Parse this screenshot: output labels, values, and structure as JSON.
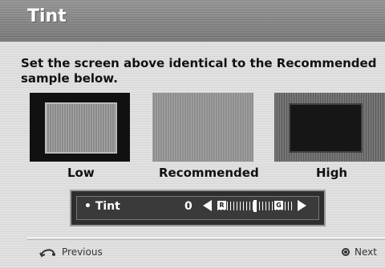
{
  "header": {
    "title": "Tint"
  },
  "instruction": "Set the screen above identical to the Recommended sample below.",
  "samples": [
    {
      "label": "Low"
    },
    {
      "label": "Recommended"
    },
    {
      "label": "High"
    }
  ],
  "setting": {
    "name": "• Tint",
    "value": "0",
    "left_end": "R",
    "right_end": "G",
    "slider_level": 0.5
  },
  "footer": {
    "previous": "Previous",
    "next": "Next"
  },
  "icons": {
    "previous": "return-icon",
    "next": "ok-button-icon",
    "left": "arrow-left-icon",
    "right": "arrow-right-icon"
  },
  "colors": {
    "title_bar": "#8c8c8c",
    "background": "#e2e2e2",
    "control_bar": "#2e2e2e"
  }
}
